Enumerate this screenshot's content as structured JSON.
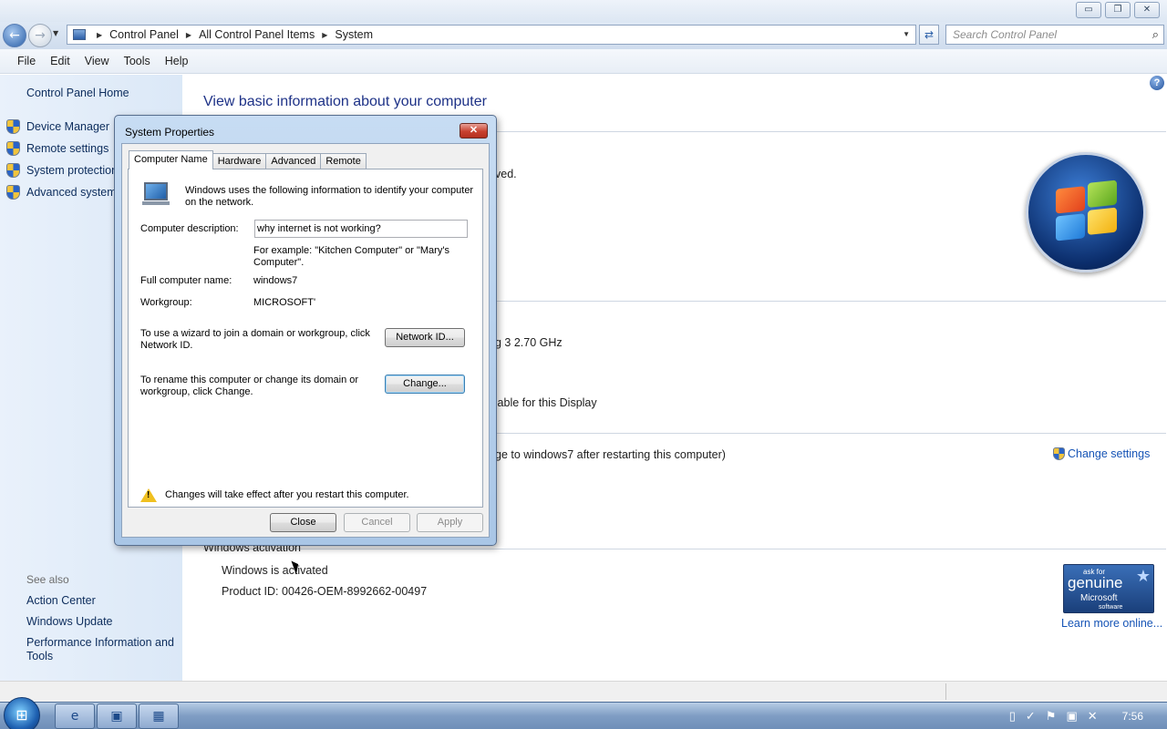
{
  "window": {
    "minimize": "▭",
    "maximize": "❐",
    "close": "✕"
  },
  "address": {
    "crumbs": [
      "Control Panel",
      "All Control Panel Items",
      "System"
    ],
    "search_placeholder": "Search Control Panel"
  },
  "menu": [
    "File",
    "Edit",
    "View",
    "Tools",
    "Help"
  ],
  "sidebar": {
    "home": "Control Panel Home",
    "items": [
      "Device Manager",
      "Remote settings",
      "System protection",
      "Advanced system"
    ],
    "see_also": "See also",
    "links": [
      "Action Center",
      "Windows Update",
      "Performance Information and Tools"
    ]
  },
  "main": {
    "title": "View basic information about your computer",
    "frag_reserved": "ved.",
    "frag_processor": "g 3   2.70 GHz",
    "frag_display": "ilable for this Display",
    "frag_computer": "ge to windows7 after restarting this computer)",
    "change_settings": "Change settings",
    "activation_heading": "Windows activation",
    "activation_status": "Windows is activated",
    "product_id": "Product ID: 00426-OEM-8992662-00497",
    "genuine": {
      "ask_for": "ask for",
      "genuine": "genuine",
      "microsoft": "Microsoft",
      "software": "software"
    },
    "learn_more": "Learn more online..."
  },
  "dialog": {
    "title": "System Properties",
    "close": "✕",
    "tabs": [
      "Computer Name",
      "Hardware",
      "Advanced",
      "Remote"
    ],
    "intro": "Windows uses the following information to identify your computer on the network.",
    "desc_label": "Computer description:",
    "desc_value": "why internet is not working?",
    "example": "For example: \"Kitchen Computer\" or \"Mary's Computer\".",
    "fullname_label": "Full computer name:",
    "fullname_value": "windows7",
    "workgroup_label": "Workgroup:",
    "workgroup_value": "MICROSOFT'",
    "wizard_text": "To use a wizard to join a domain or workgroup, click Network ID.",
    "network_id_button": "Network ID...",
    "rename_text": "To rename this computer or change its domain or workgroup, click Change.",
    "change_button": "Change...",
    "warning": "Changes will take effect after you restart this computer.",
    "close_button": "Close",
    "cancel_button": "Cancel",
    "apply_button": "Apply"
  },
  "taskbar": {
    "clock": "7:56"
  }
}
